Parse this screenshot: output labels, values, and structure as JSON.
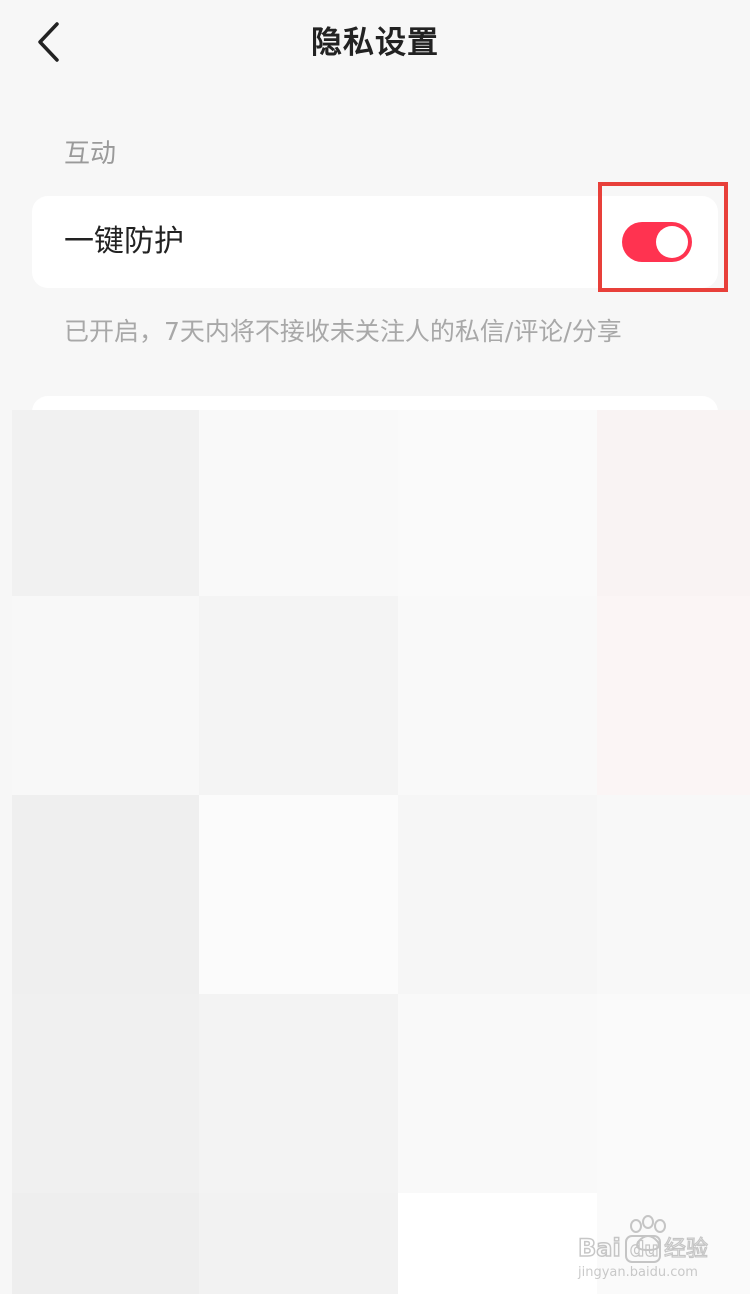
{
  "header": {
    "title": "隐私设置",
    "back_icon": "chevron-left-icon"
  },
  "section": {
    "title": "互动"
  },
  "setting": {
    "label": "一键防护",
    "toggle_on": true,
    "toggle_color": "#ff3350",
    "hint": "已开启，7天内将不接收未关注人的私信/评论/分享"
  },
  "annotation": {
    "highlight_color": "#e8403a"
  },
  "watermark": {
    "brand": "Baidu经验",
    "url": "jingyan.baidu.com"
  }
}
